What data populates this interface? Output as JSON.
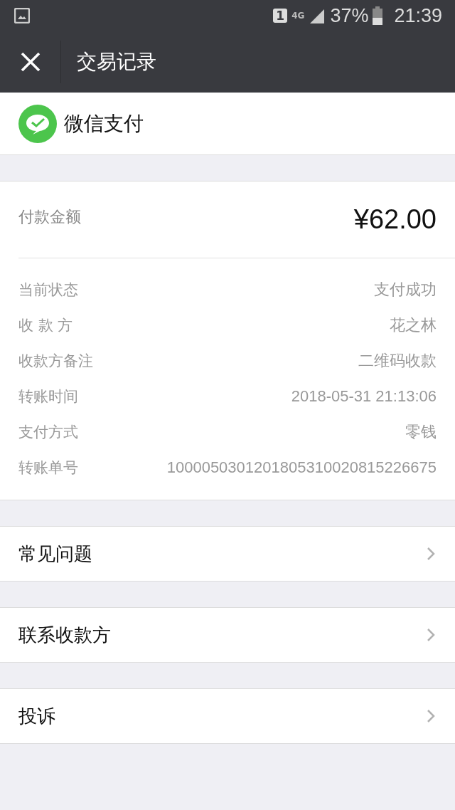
{
  "status_bar": {
    "sim_badge": "1",
    "network": "4G",
    "battery": "37%",
    "time": "21:39"
  },
  "nav": {
    "title": "交易记录"
  },
  "merchant": {
    "name": "微信支付"
  },
  "amount": {
    "label": "付款金额",
    "value": "¥62.00"
  },
  "details": [
    {
      "label": "当前状态",
      "value": "支付成功"
    },
    {
      "label": "收 款 方",
      "value": "花之林"
    },
    {
      "label": "收款方备注",
      "value": "二维码收款"
    },
    {
      "label": "转账时间",
      "value": "2018-05-31 21:13:06"
    },
    {
      "label": "支付方式",
      "value": "零钱"
    },
    {
      "label": "转账单号",
      "value": "1000050301201805310020815226675"
    }
  ],
  "menu": [
    {
      "label": "常见问题"
    },
    {
      "label": "联系收款方"
    },
    {
      "label": "投诉"
    }
  ]
}
